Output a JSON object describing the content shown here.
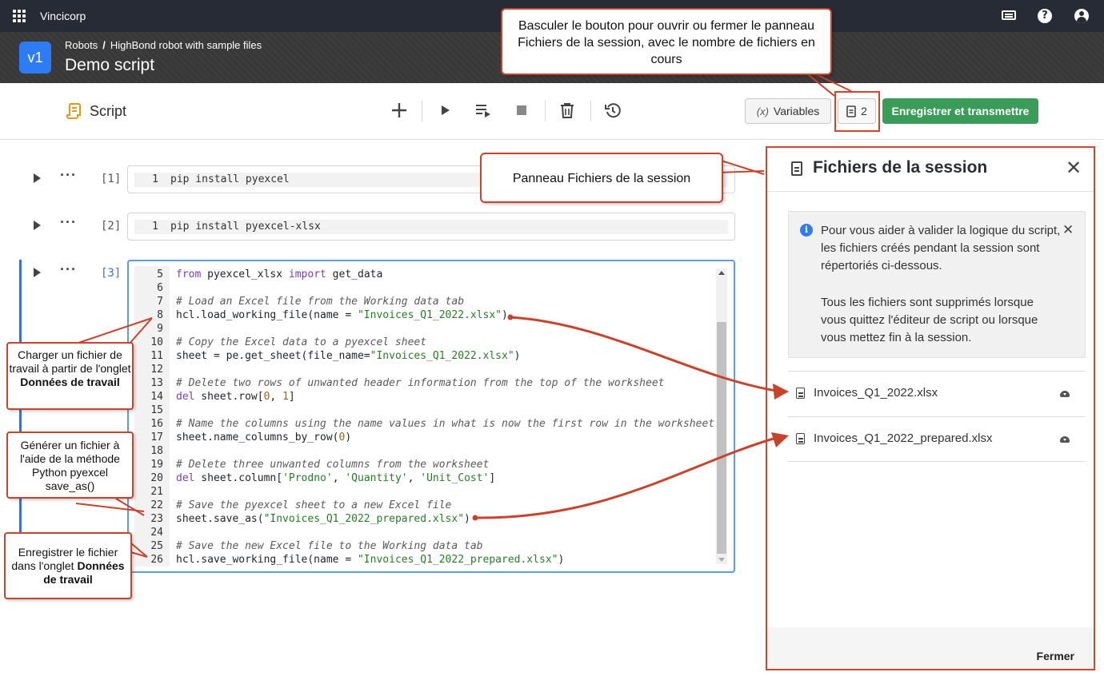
{
  "topbar": {
    "org": "Vincicorp"
  },
  "header": {
    "version_badge": "v1",
    "breadcrumb": [
      "Robots",
      "HighBond robot with sample files"
    ],
    "breadcrumb_sep": "/",
    "title": "Demo script"
  },
  "toolbar": {
    "script_label": "Script",
    "variables_label": "Variables",
    "variables_prefix": "(x)",
    "files_count": "2",
    "save_label": "Enregistrer et transmettre"
  },
  "cells": [
    {
      "index": "[1]",
      "lines": [
        {
          "n": "1",
          "code": "pip install pyexcel"
        }
      ]
    },
    {
      "index": "[2]",
      "lines": [
        {
          "n": "1",
          "code": "pip install pyexcel-xlsx"
        }
      ]
    },
    {
      "index": "[3]",
      "lines": [
        {
          "n": "5",
          "parts": [
            [
              "kw",
              "from"
            ],
            [
              "",
              " pyexcel_xlsx "
            ],
            [
              "kw",
              "import"
            ],
            [
              "",
              " get_data"
            ]
          ]
        },
        {
          "n": "6",
          "parts": []
        },
        {
          "n": "7",
          "parts": [
            [
              "cm",
              "# Load an Excel file from the Working data tab"
            ]
          ]
        },
        {
          "n": "8",
          "parts": [
            [
              "",
              "hcl.load_working_file(name = "
            ],
            [
              "str",
              "\"Invoices_Q1_2022.xlsx\""
            ],
            [
              "",
              ")"
            ]
          ]
        },
        {
          "n": "9",
          "parts": []
        },
        {
          "n": "10",
          "parts": [
            [
              "cm",
              "# Copy the Excel data to a pyexcel sheet"
            ]
          ]
        },
        {
          "n": "11",
          "parts": [
            [
              "",
              "sheet = pe.get_sheet(file_name="
            ],
            [
              "str",
              "\"Invoices_Q1_2022.xlsx\""
            ],
            [
              "",
              ")"
            ]
          ]
        },
        {
          "n": "12",
          "parts": []
        },
        {
          "n": "13",
          "parts": [
            [
              "cm",
              "# Delete two rows of unwanted header information from the top of the worksheet"
            ]
          ]
        },
        {
          "n": "14",
          "parts": [
            [
              "kw",
              "del"
            ],
            [
              "",
              " sheet.row["
            ],
            [
              "num",
              "0"
            ],
            [
              "",
              ", "
            ],
            [
              "num",
              "1"
            ],
            [
              "",
              "]"
            ]
          ]
        },
        {
          "n": "15",
          "parts": []
        },
        {
          "n": "16",
          "parts": [
            [
              "cm",
              "# Name the columns using the name values in what is now the first row in the worksheet"
            ]
          ]
        },
        {
          "n": "17",
          "parts": [
            [
              "",
              "sheet.name_columns_by_row("
            ],
            [
              "num",
              "0"
            ],
            [
              "",
              ")"
            ]
          ]
        },
        {
          "n": "18",
          "parts": []
        },
        {
          "n": "19",
          "parts": [
            [
              "cm",
              "# Delete three unwanted columns from the worksheet"
            ]
          ]
        },
        {
          "n": "20",
          "parts": [
            [
              "kw",
              "del"
            ],
            [
              "",
              " sheet.column["
            ],
            [
              "str",
              "'Prodno'"
            ],
            [
              "",
              ", "
            ],
            [
              "str",
              "'Quantity'"
            ],
            [
              "",
              ", "
            ],
            [
              "str",
              "'Unit_Cost'"
            ],
            [
              "",
              "]"
            ]
          ]
        },
        {
          "n": "21",
          "parts": []
        },
        {
          "n": "22",
          "parts": [
            [
              "cm",
              "# Save the pyexcel sheet to a new Excel file"
            ]
          ]
        },
        {
          "n": "23",
          "parts": [
            [
              "",
              "sheet.save_as("
            ],
            [
              "str",
              "\"Invoices_Q1_2022_prepared.xlsx\""
            ],
            [
              "",
              ")"
            ]
          ]
        },
        {
          "n": "24",
          "parts": []
        },
        {
          "n": "25",
          "parts": [
            [
              "cm",
              "# Save the new Excel file to the Working data tab"
            ]
          ]
        },
        {
          "n": "26",
          "parts": [
            [
              "",
              "hcl.save_working_file(name = "
            ],
            [
              "str",
              "\"Invoices_Q1_2022_prepared.xlsx\""
            ],
            [
              "",
              ")"
            ]
          ]
        }
      ]
    }
  ],
  "session_panel": {
    "title": "Fichiers de la session",
    "info_p1": "Pour vous aider à valider la logique du script, les fichiers créés pendant la session sont répertoriés ci-dessous.",
    "info_p2": "Tous les fichiers sont supprimés lorsque vous quittez l'éditeur de script ou lorsque vous mettez fin à la session.",
    "files": [
      "Invoices_Q1_2022.xlsx",
      "Invoices_Q1_2022_prepared.xlsx"
    ],
    "close_label": "Fermer"
  },
  "annotations": {
    "toggle_button": "Basculer le bouton pour ouvrir ou fermer le panneau Fichiers de la session, avec le nombre de fichiers en cours",
    "panel": "Panneau Fichiers de la session",
    "load_pre": "Charger un fichier de travail à partir de l'onglet ",
    "load_bold": "Données de travail",
    "generate": "Générer un fichier à l'aide de la méthode Python pyexcel save_as()",
    "save_pre": "Enregistrer le fichier dans l'onglet ",
    "save_bold": "Données de travail"
  },
  "colors": {
    "accent_blue": "#2d7cf5",
    "save_green": "#3b9b58",
    "annotation_red": "#d0462d"
  }
}
